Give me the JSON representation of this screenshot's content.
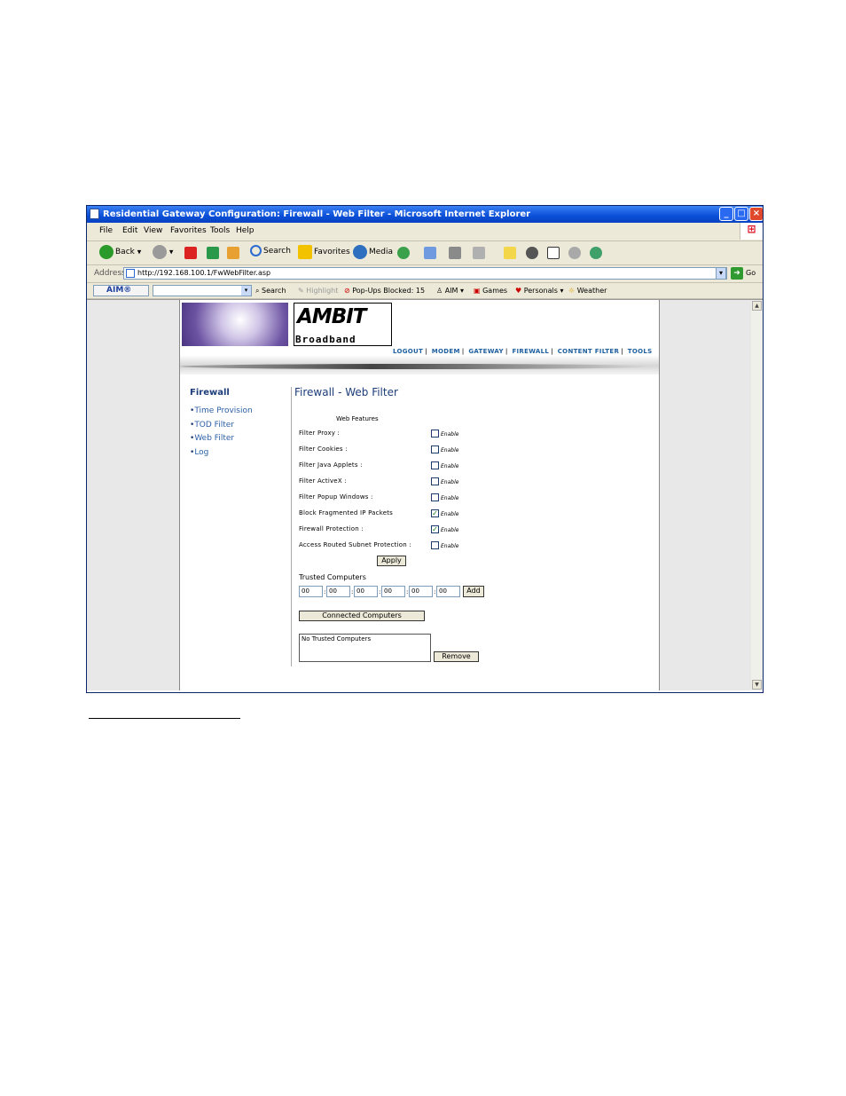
{
  "window": {
    "title": "Residential Gateway Configuration: Firewall - Web Filter - Microsoft Internet Explorer",
    "min_label": "_",
    "max_label": "□",
    "close_label": "×"
  },
  "menu": [
    "File",
    "Edit",
    "View",
    "Favorites",
    "Tools",
    "Help"
  ],
  "toolbar": {
    "back": "Back",
    "search": "Search",
    "favorites": "Favorites",
    "media": "Media"
  },
  "address": {
    "label": "Address",
    "url": "http://192.168.100.1/FwWebFilter.asp",
    "go": "Go"
  },
  "aimbar": {
    "aim": "AIM®",
    "search": "Search",
    "highlight": "Highlight",
    "popups": "Pop-Ups Blocked: 15",
    "aim_menu": "AIM",
    "games": "Games",
    "personals": "Personals",
    "weather": "Weather"
  },
  "logo": {
    "top": "AMBIT",
    "bottom": "Broadband"
  },
  "topnav": [
    "LOGOUT",
    "MODEM",
    "GATEWAY",
    "FIREWALL",
    "CONTENT FILTER",
    "TOOLS"
  ],
  "sidebar": {
    "title": "Firewall",
    "items": [
      "Time Provision",
      "TOD Filter",
      "Web Filter",
      "Log"
    ]
  },
  "main": {
    "title": "Firewall - Web Filter",
    "features_heading": "Web Features",
    "checkbox_label": "Enable",
    "features": [
      {
        "label": "Filter Proxy :",
        "checked": false
      },
      {
        "label": "Filter Cookies :",
        "checked": false
      },
      {
        "label": "Filter Java Applets :",
        "checked": false
      },
      {
        "label": "Filter ActiveX :",
        "checked": false
      },
      {
        "label": "Filter Popup Windows :",
        "checked": false
      },
      {
        "label": "Block Fragmented IP Packets",
        "checked": true
      },
      {
        "label": "Firewall Protection :",
        "checked": true
      },
      {
        "label": "Access Routed Subnet Protection :",
        "checked": false
      }
    ],
    "apply": "Apply",
    "trusted_heading": "Trusted Computers",
    "mac": [
      "00",
      "00",
      "00",
      "00",
      "00",
      "00"
    ],
    "mac_sep": ":",
    "add": "Add",
    "connected": "Connected Computers",
    "trusted_list": "No Trusted Computers",
    "remove": "Remove"
  }
}
